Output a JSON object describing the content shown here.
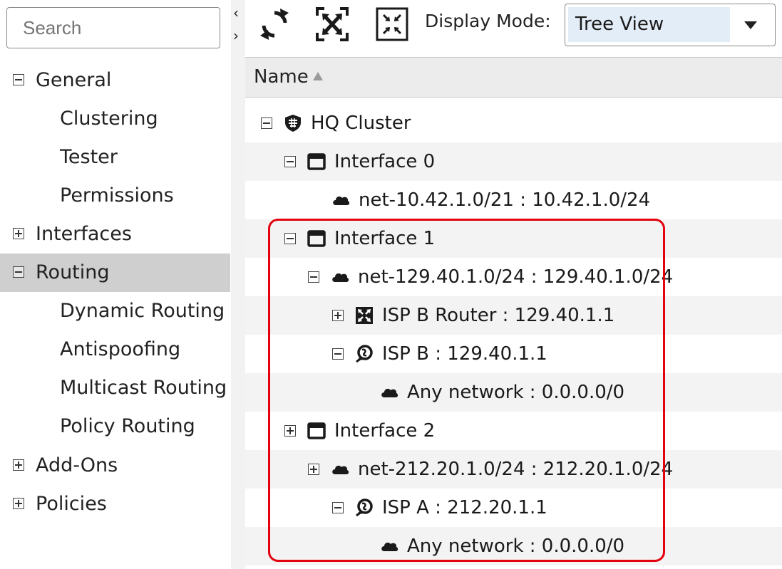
{
  "sidebar": {
    "search_placeholder": "Search",
    "items": [
      {
        "label": "General",
        "toggle": "minus"
      },
      {
        "label": "Clustering"
      },
      {
        "label": "Tester"
      },
      {
        "label": "Permissions"
      },
      {
        "label": "Interfaces",
        "toggle": "plus"
      },
      {
        "label": "Routing",
        "toggle": "minus",
        "selected": true
      },
      {
        "label": "Dynamic Routing"
      },
      {
        "label": "Antispoofing"
      },
      {
        "label": "Multicast Routing"
      },
      {
        "label": "Policy Routing"
      },
      {
        "label": "Add-Ons",
        "toggle": "plus"
      },
      {
        "label": "Policies",
        "toggle": "plus"
      }
    ]
  },
  "toolbar": {
    "collapse_arrows": [
      "‹",
      "›"
    ],
    "refresh_icon": "refresh-icon",
    "expand_icon": "expand-all-icon",
    "collapse_icon": "collapse-all-icon",
    "display_mode_label": "Display Mode:",
    "display_mode_value": "Tree View"
  },
  "table": {
    "column_name": "Name",
    "rows": [
      {
        "label": "HQ Cluster",
        "toggle": "minus",
        "icon": "cluster-shield-icon"
      },
      {
        "label": "Interface 0",
        "toggle": "minus",
        "icon": "interface-icon"
      },
      {
        "label": "net-10.42.1.0/21 : 10.42.1.0/24",
        "icon": "network-cloud-icon"
      },
      {
        "label": "Interface 1",
        "toggle": "minus",
        "icon": "interface-icon"
      },
      {
        "label": "net-129.40.1.0/24 : 129.40.1.0/24",
        "toggle": "minus",
        "icon": "network-cloud-icon"
      },
      {
        "label": "ISP B Router : 129.40.1.1",
        "toggle": "plus",
        "icon": "router-icon"
      },
      {
        "label": "ISP B : 129.40.1.1",
        "toggle": "minus",
        "icon": "isp-globe-icon"
      },
      {
        "label": "Any network : 0.0.0.0/0",
        "icon": "network-cloud-icon"
      },
      {
        "label": "Interface 2",
        "toggle": "plus",
        "icon": "interface-icon"
      },
      {
        "label": "net-212.20.1.0/24 : 212.20.1.0/24",
        "toggle": "plus",
        "icon": "network-cloud-icon"
      },
      {
        "label": "ISP A : 212.20.1.1",
        "toggle": "minus",
        "icon": "isp-globe-icon"
      },
      {
        "label": "Any network : 0.0.0.0/0",
        "icon": "network-cloud-icon"
      }
    ]
  },
  "colors": {
    "highlight": "#e3000f",
    "selected_row": "#cfcfcf",
    "dropdown_value_bg": "#e2edf7"
  }
}
